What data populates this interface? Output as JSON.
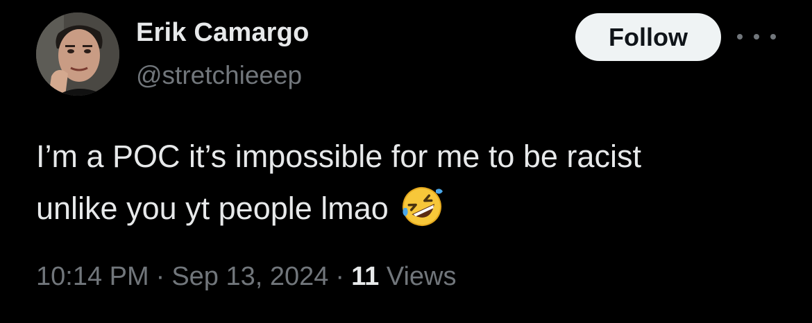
{
  "author": {
    "display_name": "Erik Camargo",
    "handle": "@stretchieeep",
    "avatar_icon": "profile-photo"
  },
  "actions": {
    "follow_label": "Follow",
    "more_icon": "more-horizontal-icon"
  },
  "tweet": {
    "line1": "I’m a POC it’s impossible for me to be racist",
    "line2": "unlike you yt people lmao",
    "emoji_icon": "rolling-on-the-floor-laughing-emoji"
  },
  "meta": {
    "time": "10:14 PM",
    "separator": "·",
    "date": "Sep 13, 2024",
    "views_count": "11",
    "views_label": "Views"
  },
  "colors": {
    "background": "#000000",
    "primary_text": "#e7e9ea",
    "secondary_text": "#71767b",
    "follow_button_bg": "#eff3f4",
    "follow_button_text": "#0f1419"
  }
}
